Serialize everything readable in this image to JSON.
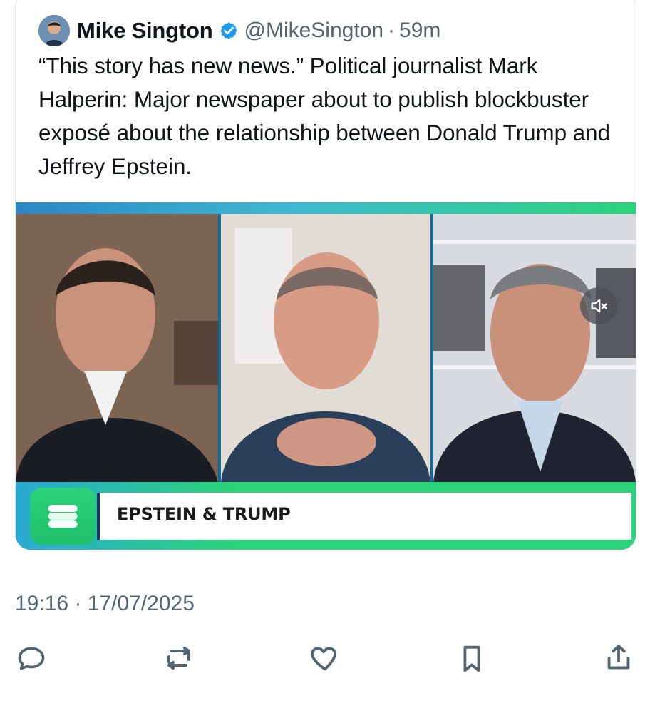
{
  "tweet": {
    "author_name": "Mike Sington",
    "author_handle": "@MikeSington",
    "separator": "·",
    "relative_time": "59m",
    "text": "“This story has new news.” Political journalist Mark Halperin: Major newspaper about to publish blockbuster exposé about the relationship between Donald Trump and Jeffrey Epstein.",
    "timestamp": "19:16 · 17/07/2025"
  },
  "video": {
    "headline": "EPSTEIN & TRUMP",
    "muted": true
  },
  "icons": {
    "verified": "verified-badge-icon",
    "reply": "reply-icon",
    "repost": "repost-icon",
    "like": "heart-icon",
    "bookmark": "bookmark-icon",
    "share": "share-icon",
    "mute": "volume-muted-icon"
  },
  "colors": {
    "verified_blue": "#1d9bf0",
    "text": "#0f1419",
    "secondary_text": "#536471",
    "border": "#e1e6ea",
    "brand_green": "#2bd37a",
    "brand_blue": "#2b86c5"
  }
}
